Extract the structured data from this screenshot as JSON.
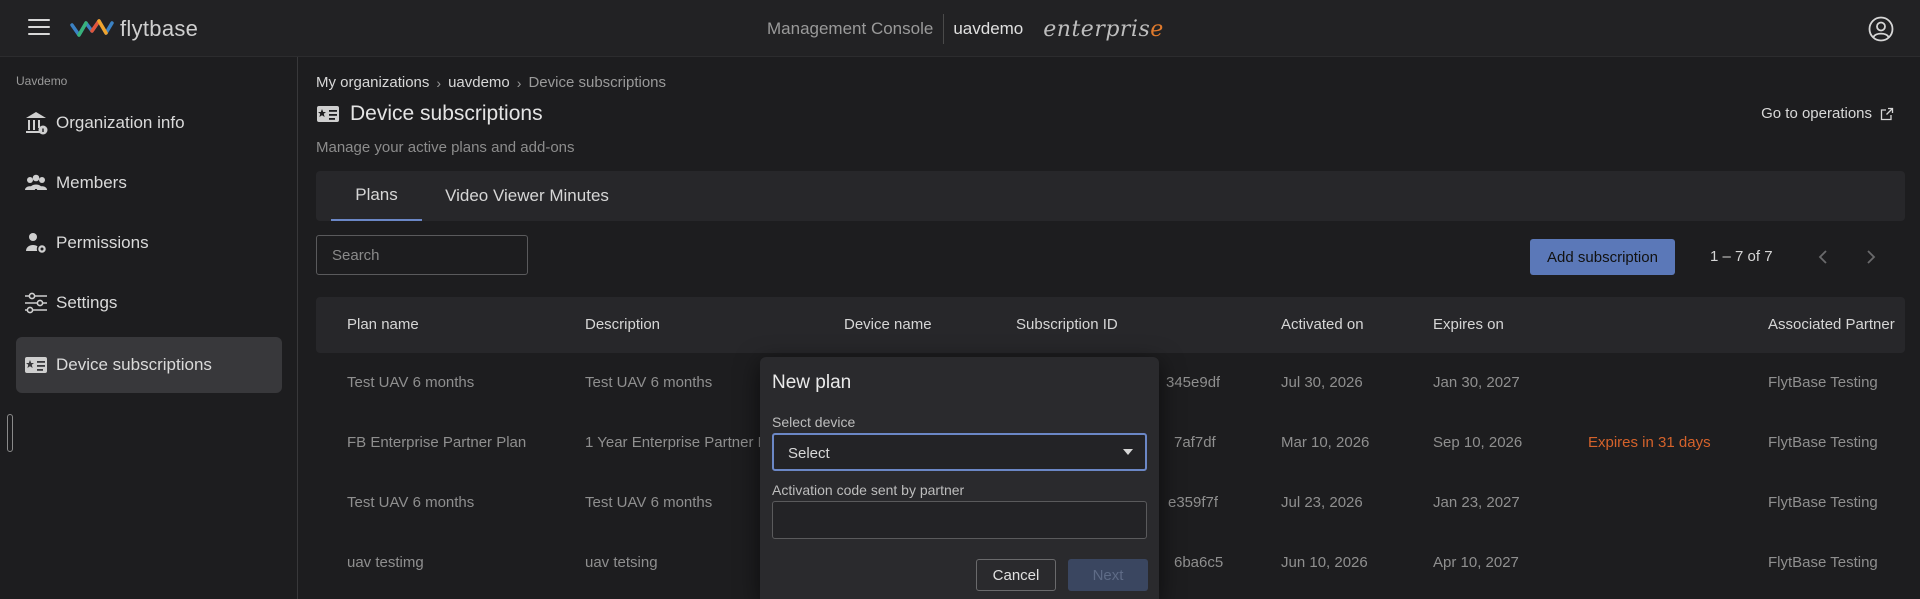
{
  "header": {
    "console_title": "Management Console",
    "org_name": "uavdemo",
    "logo_text": "flytbase",
    "edition_main": "enterpris",
    "edition_accent": "e"
  },
  "sidebar": {
    "org_label": "Uavdemo",
    "items": [
      {
        "label": "Organization info",
        "icon": "bank-icon"
      },
      {
        "label": "Members",
        "icon": "members-icon"
      },
      {
        "label": "Permissions",
        "icon": "permissions-icon"
      },
      {
        "label": "Settings",
        "icon": "sliders-icon"
      },
      {
        "label": "Device subscriptions",
        "icon": "id-card-icon",
        "active": true
      }
    ]
  },
  "breadcrumb": {
    "items": [
      "My organizations",
      "uavdemo"
    ],
    "current": "Device subscriptions"
  },
  "page": {
    "title": "Device subscriptions",
    "subtitle": "Manage your active plans and add-ons",
    "goto_ops": "Go to operations"
  },
  "tabs": [
    {
      "label": "Plans",
      "active": true
    },
    {
      "label": "Video Viewer Minutes",
      "active": false
    }
  ],
  "search": {
    "placeholder": "Search"
  },
  "toolbar": {
    "add_label": "Add subscription",
    "pager_text": "1 – 7 of 7"
  },
  "table": {
    "columns": [
      "Plan name",
      "Description",
      "Device name",
      "Subscription ID",
      "Activated on",
      "Expires on",
      "",
      "Associated Partner"
    ],
    "rows": [
      [
        "Test UAV 6 months",
        "Test UAV 6 months",
        "",
        "345e9df",
        "Jul 30, 2026",
        "Jan 30, 2027",
        "",
        "FlytBase Testing"
      ],
      [
        "FB Enterprise Partner Plan",
        "1 Year Enterprise Partner P",
        "",
        "7af7df",
        "Mar 10, 2026",
        "Sep 10, 2026",
        "Expires in 31 days",
        "FlytBase Testing"
      ],
      [
        "Test UAV 6 months",
        "Test UAV 6 months",
        "",
        "e359f7f",
        "Jul 23, 2026",
        "Jan 23, 2027",
        "",
        "FlytBase Testing"
      ],
      [
        "uav testimg",
        "uav tetsing",
        "",
        "6ba6c5",
        "Jun 10, 2026",
        "Apr 10, 2027",
        "",
        "FlytBase Testing"
      ]
    ]
  },
  "modal": {
    "title": "New plan",
    "device_label": "Select device",
    "device_value": "Select",
    "code_label": "Activation code sent by partner",
    "code_value": "",
    "cancel_label": "Cancel",
    "next_label": "Next"
  },
  "colors": {
    "accent": "#5b78b8",
    "warning": "#d4622b",
    "background": "#1d1d1f"
  }
}
